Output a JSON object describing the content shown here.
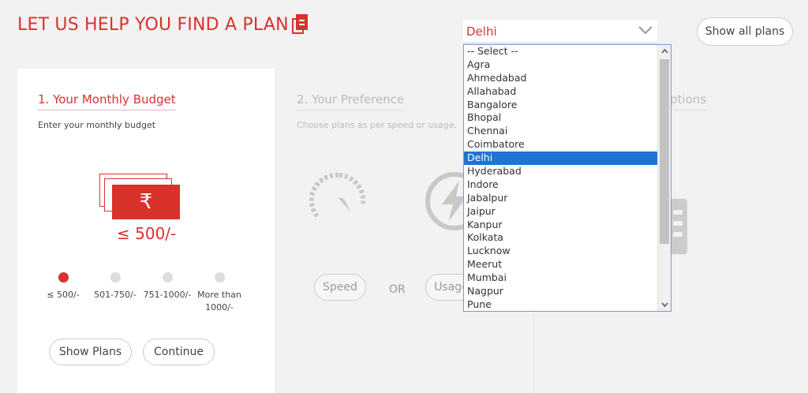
{
  "header": {
    "title": "LET US HELP YOU FIND A PLAN",
    "title_icon": "document-icon"
  },
  "city_select": {
    "value": "Delhi"
  },
  "show_all_label": "Show all plans",
  "budget": {
    "step_title": "1. Your Monthly Budget",
    "subtitle": "Enter your monthly budget",
    "currency_symbol": "₹",
    "selected_value": "≤ 500/-",
    "options": [
      "≤ 500/-",
      "501-750/-",
      "751-1000/-",
      "More than 1000/-"
    ],
    "selected_index": 0,
    "show_plans_label": "Show Plans",
    "continue_label": "Continue"
  },
  "preference": {
    "step_title": "2. Your Preference",
    "subtitle": "Choose plans as per speed or usage.",
    "speed_label": "Speed",
    "or_label": "OR",
    "usage_label": "Usage"
  },
  "options_panel": {
    "title_fragment": "ptions"
  },
  "dropdown": {
    "items": [
      "-- Select --",
      "Agra",
      "Ahmedabad",
      "Allahabad",
      "Bangalore",
      "Bhopal",
      "Chennai",
      "Coimbatore",
      "Delhi",
      "Hyderabad",
      "Indore",
      "Jabalpur",
      "Jaipur",
      "Kanpur",
      "Kolkata",
      "Lucknow",
      "Meerut",
      "Mumbai",
      "Nagpur",
      "Pune"
    ],
    "selected": "Delhi"
  },
  "colors": {
    "accent": "#d9322d",
    "selection": "#1e73d3",
    "background": "#f2f2f2"
  }
}
